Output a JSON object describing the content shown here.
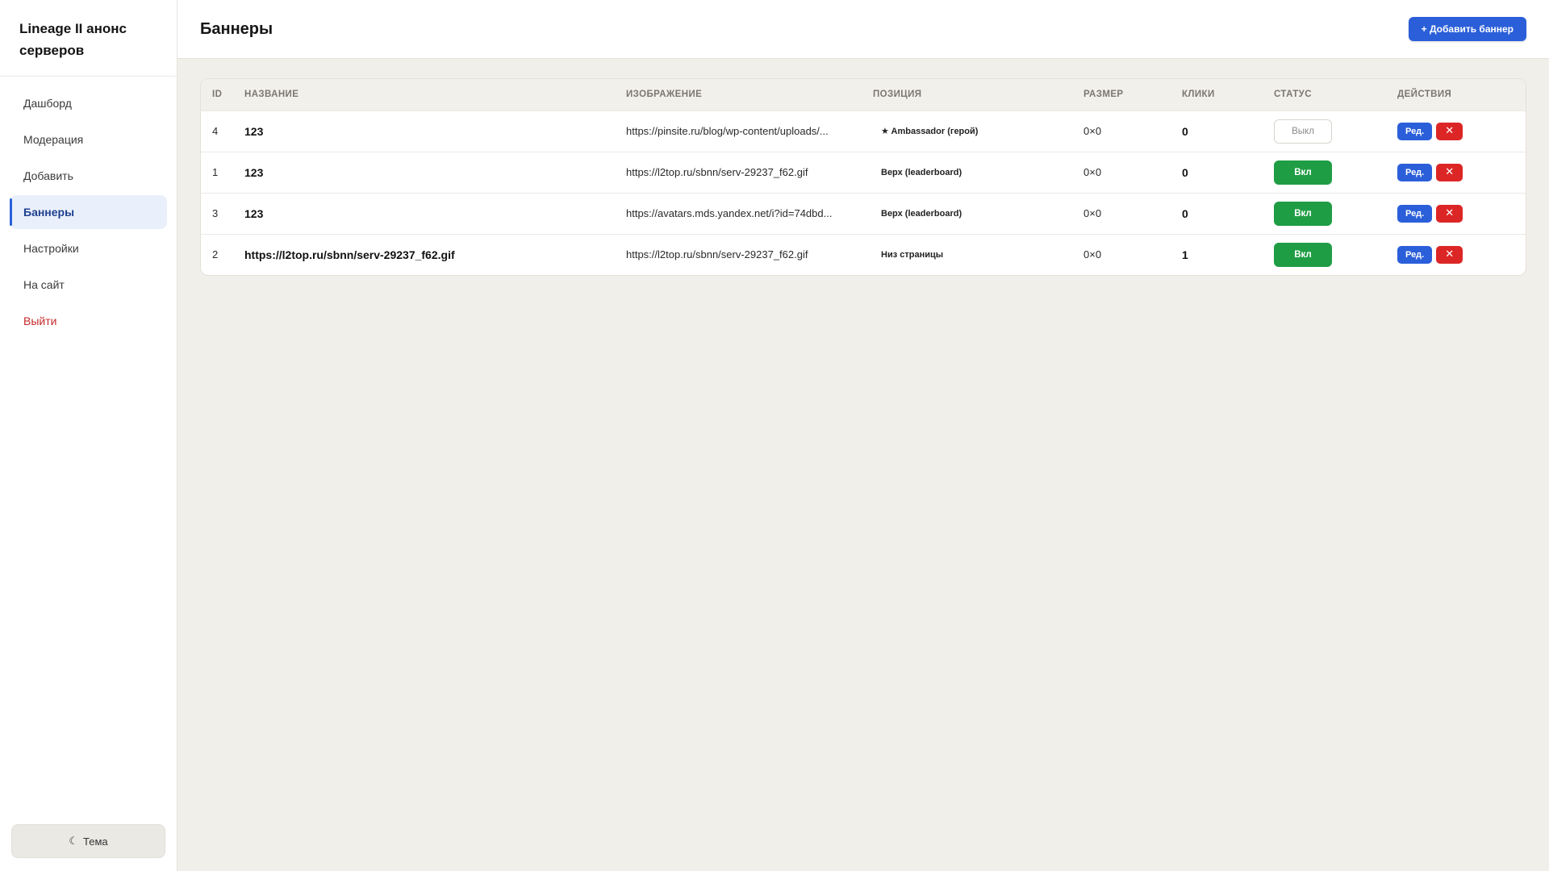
{
  "app": {
    "brand_line1": "Lineage II анонс",
    "brand_line2": "серверов"
  },
  "sidebar": {
    "items": [
      {
        "label": "Дашборд"
      },
      {
        "label": "Модерация"
      },
      {
        "label": "Добавить"
      },
      {
        "label": "Баннеры",
        "active": true
      },
      {
        "label": "Настройки"
      },
      {
        "label": "На сайт"
      },
      {
        "label": "Выйти"
      }
    ],
    "theme_icon": "☾",
    "theme_label": "Тема"
  },
  "header": {
    "title": "Баннеры",
    "add_button": "+ Добавить баннер"
  },
  "table": {
    "columns": [
      "ID",
      "НАЗВАНИЕ",
      "ИЗОБРАЖЕНИЕ",
      "ПОЗИЦИЯ",
      "РАЗМЕР",
      "КЛИКИ",
      "СТАТУС",
      "ДЕЙСТВИЯ"
    ],
    "rows": [
      {
        "id": "4",
        "name": "123",
        "image": "https://pinsite.ru/blog/wp-content/uploads/...",
        "position": "★ Ambassador (герой)",
        "size": "0×0",
        "clicks": "0",
        "status": "Выкл",
        "status_on": false
      },
      {
        "id": "1",
        "name": "123",
        "image": "https://l2top.ru/sbnn/serv-29237_f62.gif",
        "position": "Верх (leaderboard)",
        "size": "0×0",
        "clicks": "0",
        "status": "Вкл",
        "status_on": true
      },
      {
        "id": "3",
        "name": "123",
        "image": "https://avatars.mds.yandex.net/i?id=74dbd...",
        "position": "Верх (leaderboard)",
        "size": "0×0",
        "clicks": "0",
        "status": "Вкл",
        "status_on": true
      },
      {
        "id": "2",
        "name": "https://l2top.ru/sbnn/serv-29237_f62.gif",
        "image": "https://l2top.ru/sbnn/serv-29237_f62.gif",
        "position": "Низ страницы",
        "size": "0×0",
        "clicks": "1",
        "status": "Вкл",
        "status_on": true
      }
    ],
    "edit_label": "Ред.",
    "delete_label": "✕"
  },
  "colors": {
    "accent": "#2b5fd9",
    "success": "#1f9d45",
    "danger": "#dc2626",
    "background": "#f1efe9"
  }
}
